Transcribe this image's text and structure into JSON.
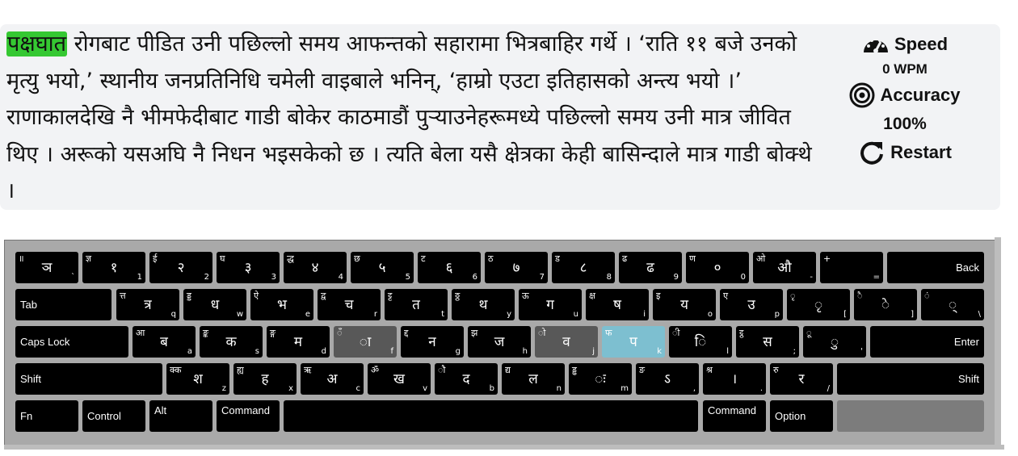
{
  "passage": {
    "highlighted_word": "पक्षघात",
    "rest": " रोगबाट पीडित उनी पछिल्लो समय आफन्तको सहारामा भित्रबाहिर गर्थे । ‘राति ११ बजे उनको मृत्यु भयो,’ स्थानीय जनप्रतिनिधि चमेली वाइबाले भनिन्, ‘हाम्रो एउटा इतिहासको अन्त्य भयो ।’ राणाकालदेखि नै भीमफेदीबाट गाडी बोकेर काठमाडौं पुऱ्याउनेहरूमध्ये पछिल्लो समय उनी मात्र जीवित थिए । अरूको यसअघि नै निधन भइसकेको छ । त्यति बेला यसै क्षेत्रका केही बासिन्दाले मात्र गाडी बोक्थे ।"
  },
  "stats": {
    "speed_label": "Speed",
    "speed_value": "0 WPM",
    "accuracy_label": "Accuracy",
    "accuracy_value": "100%",
    "restart_label": "Restart"
  },
  "colors": {
    "highlight": "#35c832",
    "active_key": "#7dbfd0",
    "home_key": "#585858"
  },
  "keyboard": {
    "rows": [
      [
        {
          "s": "॥",
          "m": "ञ",
          "e": "`"
        },
        {
          "s": "ज्ञ",
          "m": "१",
          "e": "1"
        },
        {
          "s": "ई",
          "m": "२",
          "e": "2"
        },
        {
          "s": "घ",
          "m": "३",
          "e": "3"
        },
        {
          "s": "द्ध",
          "m": "४",
          "e": "4"
        },
        {
          "s": "छ",
          "m": "५",
          "e": "5"
        },
        {
          "s": "ट",
          "m": "६",
          "e": "6"
        },
        {
          "s": "ठ",
          "m": "७",
          "e": "7"
        },
        {
          "s": "ड",
          "m": "८",
          "e": "8"
        },
        {
          "s": "ढ",
          "m": "ढ",
          "e": "9"
        },
        {
          "s": "ण",
          "m": "०",
          "e": "0"
        },
        {
          "s": "ओ",
          "m": "औ",
          "e": "-"
        },
        {
          "s": "+",
          "m": "",
          "e": "="
        },
        {
          "l": "Back"
        }
      ],
      [
        {
          "l": "Tab"
        },
        {
          "s": "त्त",
          "m": "त्र",
          "e": "q"
        },
        {
          "s": "ड्ड",
          "m": "ध",
          "e": "w"
        },
        {
          "s": "ऐ",
          "m": "भ",
          "e": "e"
        },
        {
          "s": "द्व",
          "m": "च",
          "e": "r"
        },
        {
          "s": "ट्ट",
          "m": "त",
          "e": "t"
        },
        {
          "s": "ठ्ठ",
          "m": "थ",
          "e": "y"
        },
        {
          "s": "ऊ",
          "m": "ग",
          "e": "u"
        },
        {
          "s": "क्ष",
          "m": "ष",
          "e": "i"
        },
        {
          "s": "इ",
          "m": "य",
          "e": "o"
        },
        {
          "s": "ए",
          "m": "उ",
          "e": "p"
        },
        {
          "s": "ृ",
          "m": "ृ",
          "e": "["
        },
        {
          "s": "ै",
          "m": "े",
          "e": "]"
        },
        {
          "s": "ं",
          "m": "्",
          "e": "\\"
        }
      ],
      [
        {
          "l": "Caps Lock"
        },
        {
          "s": "आ",
          "m": "ब",
          "e": "a"
        },
        {
          "s": "ङ्क",
          "m": "क",
          "e": "s"
        },
        {
          "s": "ङ्ग",
          "m": "म",
          "e": "d"
        },
        {
          "s": "ँ",
          "m": "ा",
          "e": "f"
        },
        {
          "s": "द्द",
          "m": "न",
          "e": "g"
        },
        {
          "s": "झ",
          "m": "ज",
          "e": "h"
        },
        {
          "s": "ो",
          "m": "व",
          "e": "j"
        },
        {
          "s": "फ",
          "m": "प",
          "e": "k"
        },
        {
          "s": "ी",
          "m": "ि",
          "e": "l"
        },
        {
          "s": "ट्ठ",
          "m": "स",
          "e": ";"
        },
        {
          "s": "ू",
          "m": "ु",
          "e": "'"
        },
        {
          "l": "Enter"
        }
      ],
      [
        {
          "l": "Shift"
        },
        {
          "s": "क्क",
          "m": "श",
          "e": "z"
        },
        {
          "s": "ह्य",
          "m": "ह",
          "e": "x"
        },
        {
          "s": "ऋ",
          "m": "अ",
          "e": "c"
        },
        {
          "s": "ॐ",
          "m": "ख",
          "e": "v"
        },
        {
          "s": "ौ",
          "m": "द",
          "e": "b"
        },
        {
          "s": "द्य",
          "m": "ल",
          "e": "n"
        },
        {
          "s": "ड्ढ",
          "m": "ः",
          "e": "m"
        },
        {
          "s": "ङ",
          "m": "ऽ",
          "e": ","
        },
        {
          "s": "श्र",
          "m": "।",
          "e": "."
        },
        {
          "s": "रु",
          "m": "र",
          "e": "/"
        },
        {
          "l": "Shift"
        }
      ],
      [
        {
          "l": "Fn"
        },
        {
          "l": "Control"
        },
        {
          "l": "Alt"
        },
        {
          "l": "Command"
        },
        {
          "l": ""
        },
        {
          "l": "Command"
        },
        {
          "l": "Option"
        },
        {
          "l": ""
        }
      ]
    ]
  }
}
